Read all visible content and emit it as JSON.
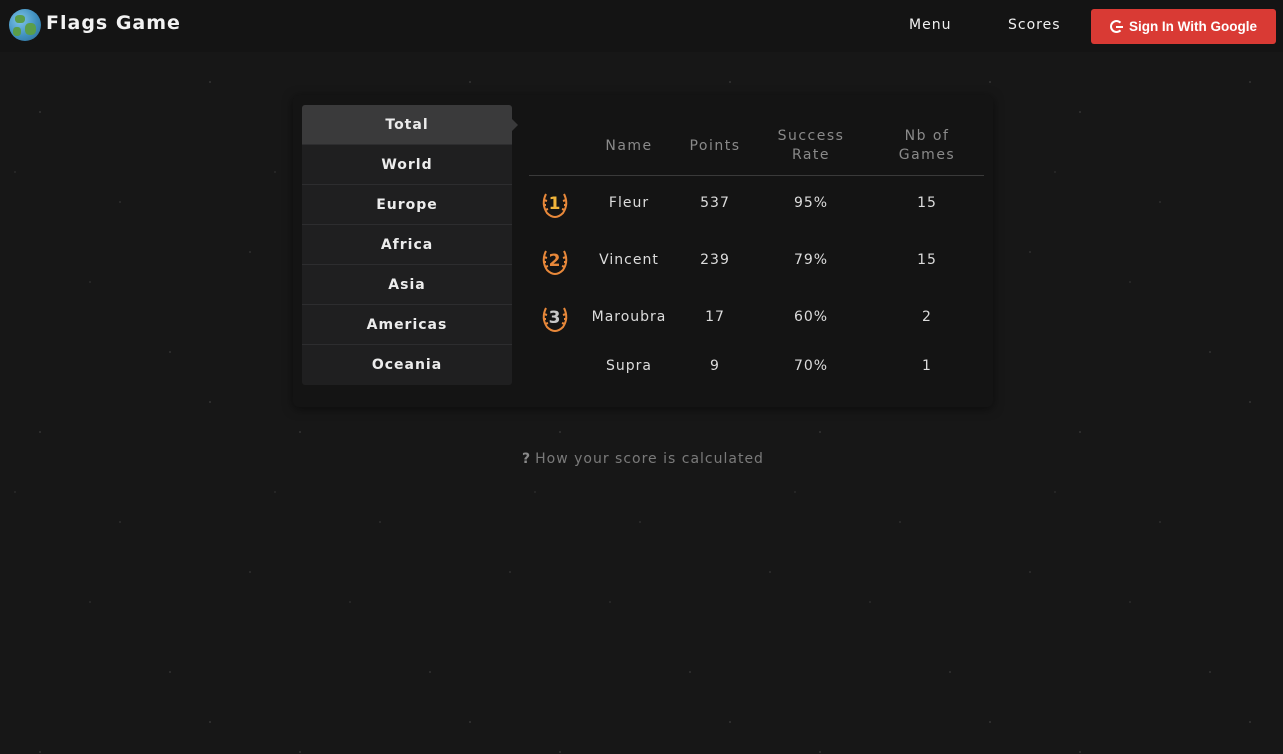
{
  "header": {
    "brand": "Flags Game",
    "nav": {
      "menu": "Menu",
      "scores": "Scores"
    },
    "sign_in": "Sign In With Google",
    "icons": {
      "logo": "globe-icon",
      "google": "google-g-icon"
    },
    "colors": {
      "sign_in_bg": "#d93a34"
    }
  },
  "tabs": [
    {
      "label": "Total",
      "active": true
    },
    {
      "label": "World"
    },
    {
      "label": "Europe"
    },
    {
      "label": "Africa"
    },
    {
      "label": "Asia"
    },
    {
      "label": "Americas"
    },
    {
      "label": "Oceania"
    }
  ],
  "table": {
    "columns": {
      "name": "Name",
      "points": "Points",
      "rate_1": "Success",
      "rate_2": "Rate",
      "games_1": "Nb of",
      "games_2": "Games"
    },
    "rows": [
      {
        "rank": "1",
        "name": "Fleur",
        "points": "537",
        "rate": "95%",
        "games": "15",
        "medal_color": "#f0b43a"
      },
      {
        "rank": "2",
        "name": "Vincent",
        "points": "239",
        "rate": "79%",
        "games": "15",
        "medal_color": "#e8883a"
      },
      {
        "rank": "3",
        "name": "Maroubra",
        "points": "17",
        "rate": "60%",
        "games": "2",
        "medal_color": "#c8c8c8"
      },
      {
        "rank": "",
        "name": "Supra",
        "points": "9",
        "rate": "70%",
        "games": "1"
      }
    ]
  },
  "help": {
    "icon": "question-icon",
    "text": "How your score is calculated"
  }
}
